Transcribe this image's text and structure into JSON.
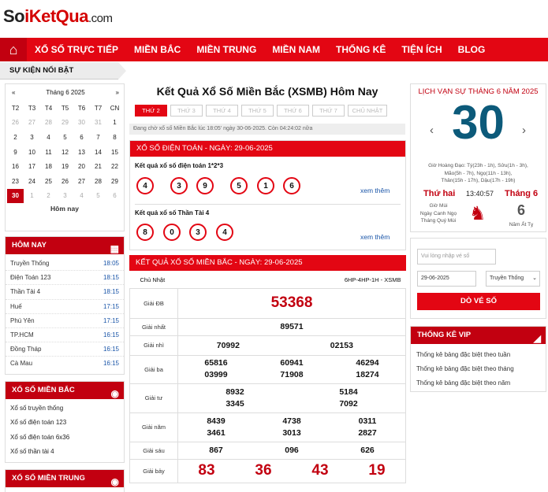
{
  "header": {
    "logo_a": "So",
    "logo_b": "iKetQua",
    "logo_c": ".com"
  },
  "nav": [
    "XỔ SỐ TRỰC TIẾP",
    "MIỀN BẮC",
    "MIỀN TRUNG",
    "MIỀN NAM",
    "THỐNG KÊ",
    "TIỆN ÍCH",
    "BLOG"
  ],
  "featured": "SỰ KIỆN NỔI BẬT",
  "calendar": {
    "month": "Tháng 6 2025",
    "prev": "«",
    "next": "»",
    "days": [
      "T2",
      "T3",
      "T4",
      "T5",
      "T6",
      "T7",
      "CN"
    ],
    "rows": [
      [
        "26",
        "27",
        "28",
        "29",
        "30",
        "31",
        "1"
      ],
      [
        "2",
        "3",
        "4",
        "5",
        "6",
        "7",
        "8"
      ],
      [
        "9",
        "10",
        "11",
        "12",
        "13",
        "14",
        "15"
      ],
      [
        "16",
        "17",
        "18",
        "19",
        "20",
        "21",
        "22"
      ],
      [
        "23",
        "24",
        "25",
        "26",
        "27",
        "28",
        "29"
      ],
      [
        "30",
        "1",
        "2",
        "3",
        "4",
        "5",
        "6"
      ]
    ],
    "today": "Hôm nay"
  },
  "today_box": {
    "title": "HÔM NAY",
    "items": [
      {
        "name": "Truyền Thống",
        "time": "18:05"
      },
      {
        "name": "Điện Toán 123",
        "time": "18:15"
      },
      {
        "name": "Thần Tài 4",
        "time": "18:15"
      },
      {
        "name": "Huế",
        "time": "17:15"
      },
      {
        "name": "Phú Yên",
        "time": "17:15"
      },
      {
        "name": "TP.HCM",
        "time": "16:15"
      },
      {
        "name": "Đồng Tháp",
        "time": "16:15"
      },
      {
        "name": "Cà Mau",
        "time": "16:15"
      }
    ]
  },
  "mb_box": {
    "title": "XỔ SỐ MIỀN BẮC",
    "links": [
      "Xổ số truyền thống",
      "Xổ số điện toán 123",
      "Xổ số điện toán 6x36",
      "Xổ số thần tài 4"
    ]
  },
  "mt_box": {
    "title": "XỔ SỐ MIỀN TRUNG"
  },
  "main": {
    "title": "Kết Quả Xổ Số Miền Bắc (XSMB) Hôm Nay",
    "tabs": [
      "THỨ 2",
      "THỨ 3",
      "THỨ 4",
      "THỨ 5",
      "THỨ 6",
      "THỨ 7",
      "CHỦ NHẬT"
    ],
    "note": "Đang chờ xổ số Miền Bắc lúc 18:05' ngày 30-06-2025. Còn 04:24:02 nữa",
    "dt_title": "XỔ SỐ ĐIỆN TOÁN - NGÀY: 29-06-2025",
    "dt_label1": "Kết quả xổ số điện toán 1*2*3",
    "dt_balls1": [
      "4",
      "3",
      "9",
      "5",
      "1",
      "6"
    ],
    "dt_label2": "Kết quả xổ số Thần Tài 4",
    "dt_balls2": [
      "8",
      "0",
      "3",
      "4"
    ],
    "more": "xem thêm",
    "kq_title": "KẾT QUẢ XỔ SỐ MIỀN BẮC - NGÀY: 29-06-2025",
    "day": "Chủ Nhật",
    "code": "6HP-4HP-1H - XSMB",
    "prizes": [
      {
        "name": "Giải ĐB",
        "vals": [
          "53368"
        ]
      },
      {
        "name": "Giải nhất",
        "vals": [
          "89571"
        ]
      },
      {
        "name": "Giải nhì",
        "vals": [
          "70992",
          "02153"
        ]
      },
      {
        "name": "Giải ba",
        "vals": [
          "65816",
          "60941",
          "46294",
          "03999",
          "71908",
          "18274"
        ]
      },
      {
        "name": "Giải tư",
        "vals": [
          "8932",
          "5184",
          "3345",
          "7092"
        ]
      },
      {
        "name": "Giải năm",
        "vals": [
          "8439",
          "4738",
          "0311",
          "3461",
          "3013",
          "2827"
        ]
      },
      {
        "name": "Giải sáu",
        "vals": [
          "867",
          "096",
          "626"
        ]
      },
      {
        "name": "Giải bảy",
        "vals": [
          "83",
          "36",
          "43",
          "19"
        ]
      }
    ]
  },
  "lunar": {
    "title": "LỊCH VẠN SỰ THÁNG 6 NĂM 2025",
    "day": "30",
    "left": "‹",
    "right": "›",
    "gio1": "Giờ Hoàng Đạo: Tý(23h - 1h), Sửu(1h - 3h),",
    "gio2": "Mão(5h - 7h), Ngọ(11h - 13h),",
    "gio3": "Thân(15h - 17h), Dậu(17h - 19h)",
    "weekday": "Thứ hai",
    "clock": "13:40:57",
    "month_label": "Tháng 6",
    "lunar_day": "6",
    "l1": "Giờ Mùi",
    "l2": "Ngày Canh Ngọ",
    "l3": "Tháng Quý Mùi",
    "year": "Năm Ất Tỵ"
  },
  "search": {
    "ph": "Vui lòng nhập vé số",
    "date": "29-06-2025",
    "select": "Truyền Thống",
    "button": "DÒ VÉ SỐ"
  },
  "vip": {
    "title": "THỐNG KÊ VIP",
    "links": [
      "Thống kê bảng đặc biệt theo tuần",
      "Thống kê bảng đặc biệt theo tháng",
      "Thống kê bảng đặc biệt theo năm"
    ]
  }
}
